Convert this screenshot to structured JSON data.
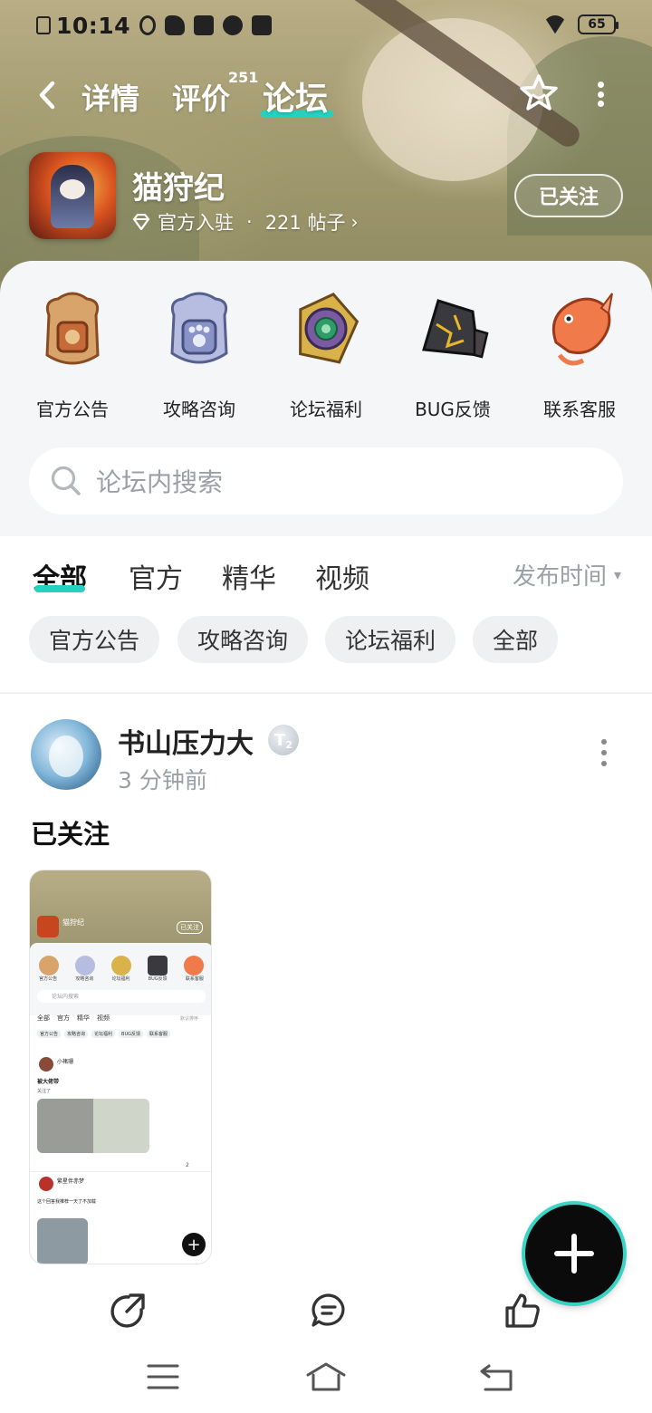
{
  "status_bar": {
    "time": "10:14",
    "battery": "65",
    "icons": [
      "x-box-icon",
      "tiktok-icon",
      "bird-icon",
      "play-icon",
      "link-icon",
      "bag-icon",
      "wifi-icon",
      "battery-icon"
    ]
  },
  "header": {
    "tabs": [
      {
        "label": "详情",
        "active": false
      },
      {
        "label": "评价",
        "active": false,
        "badge": "251"
      },
      {
        "label": "论坛",
        "active": true
      }
    ],
    "accent": "#27d0c0"
  },
  "game": {
    "title": "猫狩纪",
    "official": "官方入驻",
    "posts": "221 帖子",
    "follow_label": "已关注"
  },
  "quick_links": [
    {
      "label": "官方公告",
      "icon": "announcement-icon"
    },
    {
      "label": "攻略咨询",
      "icon": "guide-icon"
    },
    {
      "label": "论坛福利",
      "icon": "welfare-icon"
    },
    {
      "label": "BUG反馈",
      "icon": "bug-report-icon"
    },
    {
      "label": "联系客服",
      "icon": "customer-service-icon"
    }
  ],
  "search": {
    "placeholder": "论坛内搜索"
  },
  "feed_tabs": [
    {
      "label": "全部",
      "active": true
    },
    {
      "label": "官方",
      "active": false
    },
    {
      "label": "精华",
      "active": false
    },
    {
      "label": "视频",
      "active": false
    }
  ],
  "sort": {
    "label": "发布时间"
  },
  "filter_chips": [
    "官方公告",
    "攻略咨询",
    "论坛福利",
    "全部"
  ],
  "post": {
    "author": "书山压力大",
    "level": "T",
    "level_sub": "2",
    "time": "3 分钟前",
    "title": "已关注"
  },
  "thumbnail_texts": {
    "game": "猫狩纪",
    "follow": "已关注",
    "search": "论坛内搜索",
    "tabs": [
      "全部",
      "官方",
      "精华",
      "视频"
    ],
    "sort": "默认排序",
    "chips": [
      "官方公告",
      "攻略咨询",
      "论坛福利",
      "BUG反馈",
      "联系客服"
    ],
    "links": [
      "官方公告",
      "攻略咨询",
      "论坛福利",
      "BUG反馈",
      "联系客服"
    ],
    "user1": "小褚珊",
    "user1_post": "被大佬带",
    "user1_sub": "关注了",
    "likes": "2",
    "user2": "繁星伴赤梦",
    "user2_post": "这个回答我推荐一天了不加载"
  }
}
